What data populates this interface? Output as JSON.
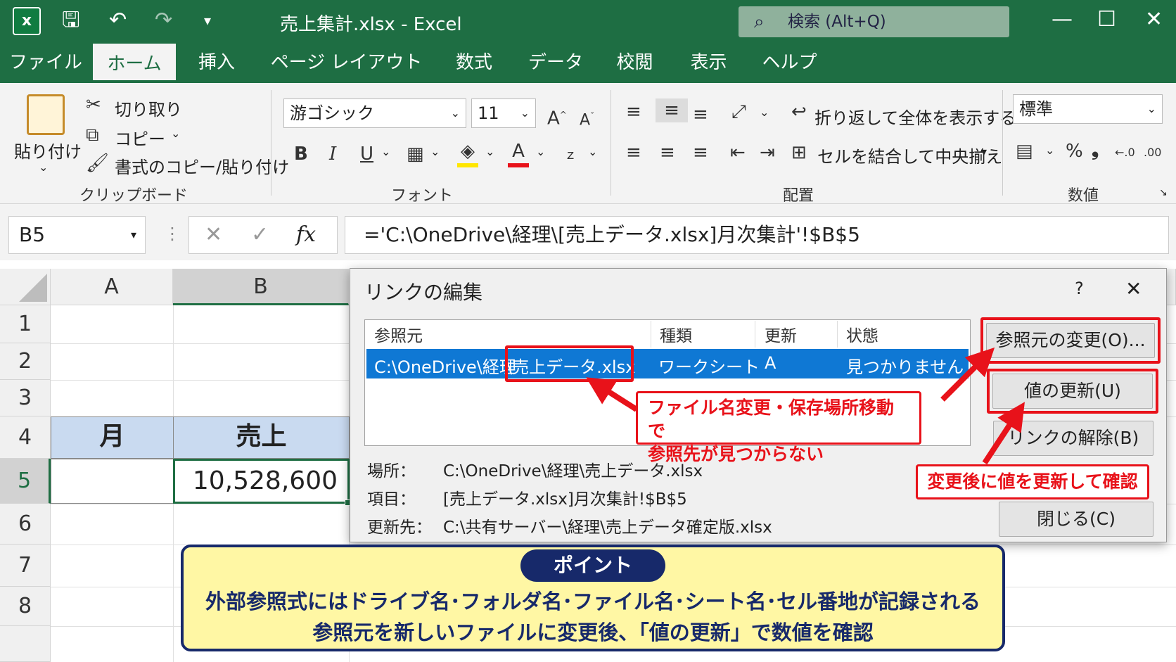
{
  "window": {
    "title": "売上集計.xlsx  -  Excel",
    "search": "検索 (Alt+Q)"
  },
  "tabs": [
    "ファイル",
    "ホーム",
    "挿入",
    "ページ レイアウト",
    "数式",
    "データ",
    "校閲",
    "表示",
    "ヘルプ"
  ],
  "active_tab": "ホーム",
  "ribbon": {
    "clipboard": {
      "paste": "貼り付け",
      "cut": "切り取り",
      "copy": "コピー",
      "format_painter": "書式のコピー/貼り付け",
      "group": "クリップボード"
    },
    "font": {
      "name": "游ゴシック",
      "size": "11",
      "bold": "B",
      "italic": "I",
      "underline": "U",
      "group": "フォント"
    },
    "alignment": {
      "wrap": "折り返して全体を表示する",
      "merge": "セルを結合して中央揃え",
      "group": "配置"
    },
    "number": {
      "format": "標準",
      "percent": "%",
      "group": "数値"
    }
  },
  "formula_bar": {
    "name_box": "B5",
    "fx": "fx",
    "formula": "='C:\\OneDrive\\経理\\[売上データ.xlsx]月次集計'!$B$5"
  },
  "sheet": {
    "columns": [
      "A",
      "B"
    ],
    "rows": [
      "1",
      "2",
      "3",
      "4",
      "5",
      "6",
      "7",
      "8"
    ],
    "header_month": "月",
    "header_sales": "売上",
    "b5_value": "10,528,600"
  },
  "dialog": {
    "title": "リンクの編集",
    "help": "?",
    "close_x": "✕",
    "columns": [
      "参照元",
      "種類",
      "更新",
      "状態"
    ],
    "row": {
      "source_prefix": "C:\\OneDrive\\経理",
      "source_file": "\\売上データ.xlsx",
      "type": "ワークシート",
      "update": "A",
      "status": "見つかりません"
    },
    "info_labels": [
      "場所：",
      "項目：",
      "更新先："
    ],
    "info_values": [
      "C:\\OneDrive\\経理\\売上データ.xlsx",
      "[売上データ.xlsx]月次集計!$B$5",
      "C:\\共有サーバー\\経理\\売上データ確定版.xlsx"
    ],
    "buttons": {
      "change_source": "参照元の変更(O)...",
      "update_values": "値の更新(U)",
      "break_link": "リンクの解除(B)",
      "close": "閉じる(C)"
    }
  },
  "annotations": {
    "not_found_line1": "ファイル名変更・保存場所移動で",
    "not_found_line2": "参照先が見つからない",
    "update_note": "変更後に値を更新して確認",
    "point_title": "ポイント",
    "point_line1": "外部参照式にはドライブ名･フォルダ名･ファイル名･シート名･セル番地が記録される",
    "point_line2": "参照元を新しいファイルに変更後、「値の更新」で数値を確認"
  },
  "colors": {
    "excel_green": "#1e6e43",
    "selection_blue": "#0f78d4",
    "callout_red": "#e8121a",
    "point_navy": "#17296a",
    "point_yellow": "#fff7a4",
    "header_blue": "#c9daf0"
  }
}
